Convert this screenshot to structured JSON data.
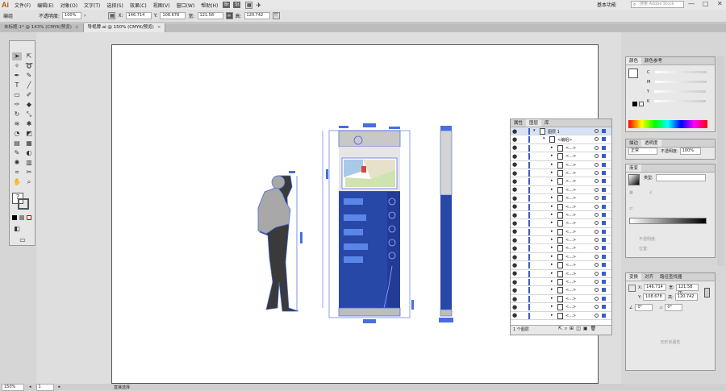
{
  "app": {
    "logo": "Ai",
    "menus": [
      "文件(F)",
      "编辑(E)",
      "对象(O)",
      "文字(T)",
      "选择(S)",
      "效果(C)",
      "视图(V)",
      "窗口(W)",
      "帮助(H)"
    ],
    "app_icons": [
      "Br",
      "St"
    ],
    "workspace": "基本功能",
    "search_placeholder": "搜索 Adobe Stock",
    "win_min": "—",
    "win_max": "□",
    "win_close": "✕"
  },
  "control": {
    "selection_label": "编组",
    "opacity_label": "不透明度:",
    "opacity": "100%",
    "x_label": "X:",
    "x": "146.714",
    "y_label": "Y:",
    "y": "108.678",
    "w_label": "宽:",
    "w": "121.58",
    "h_label": "高:",
    "h": "120.742"
  },
  "tabs": [
    {
      "label": "未标题-1* @ 143% (CMYK/预览)",
      "close": "×"
    },
    {
      "label": "导视牌.ai @ 150% (CMYK/预览)",
      "close": "×"
    }
  ],
  "status": {
    "zoom": "150%",
    "page": "1",
    "tool": "直接选择"
  },
  "color_panel": {
    "tabs": [
      "颜色",
      "颜色参考"
    ],
    "channels": [
      "C",
      "M",
      "Y",
      "K"
    ],
    "unit": "%"
  },
  "transparency": {
    "tabs": [
      "描边",
      "透明度"
    ],
    "mode": "正常",
    "opacity_label": "不透明度:",
    "opacity": "100%"
  },
  "gradient": {
    "title": "渐变",
    "type_label": "类型:",
    "opacity_label": "不透明度:",
    "position_label": "位置:"
  },
  "transform": {
    "tabs": [
      "变换",
      "对齐",
      "路径查找器"
    ],
    "x_label": "X:",
    "x": "146.714",
    "y_label": "Y:",
    "y": "108.678",
    "w_label": "宽:",
    "w": "121.58 m",
    "h_label": "高:",
    "h": "120.742",
    "angle": "0°",
    "shear": "0°",
    "empty_msg": "无形状属性"
  },
  "layers": {
    "tabs": [
      "属性",
      "图层",
      "库"
    ],
    "layer1": "图层 1",
    "group": "<编组>",
    "item": "<...>",
    "footer": "1 个图层"
  }
}
